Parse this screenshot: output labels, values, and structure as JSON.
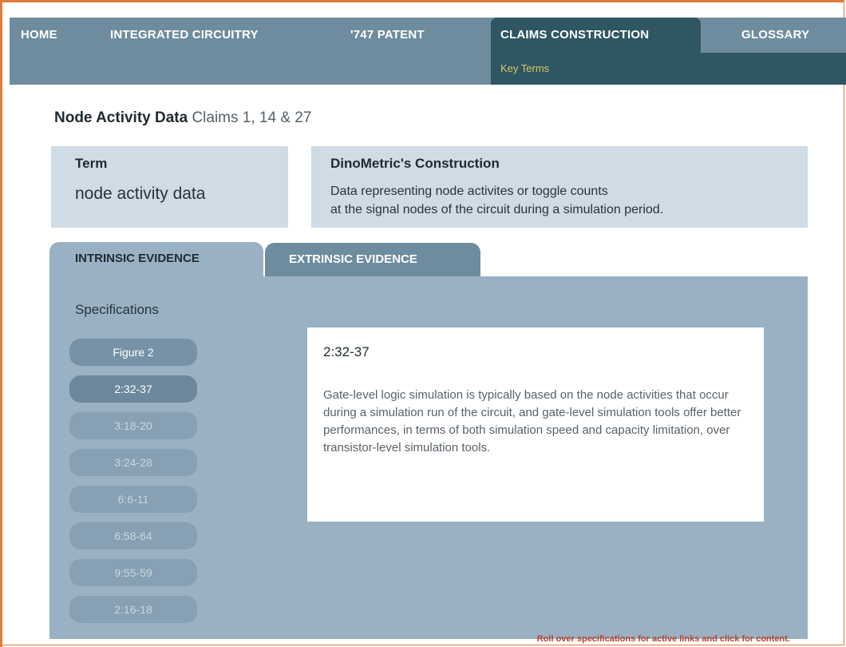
{
  "nav": {
    "home": "HOME",
    "integrated_circuitry": "INTEGRATED CIRCUITRY",
    "patent": "'747 PATENT",
    "claims_construction": "CLAIMS CONSTRUCTION",
    "glossary": "GLOSSARY",
    "subnav_key_terms": "Key Terms"
  },
  "page": {
    "title": "Node Activity Data",
    "claims": "Claims 1, 14 & 27"
  },
  "term": {
    "heading": "Term",
    "value": "node activity data"
  },
  "construction": {
    "heading": "DinoMetric's Construction",
    "line1": "Data representing node activites or toggle counts",
    "line2": "at the signal nodes of the circuit during a simulation period."
  },
  "tabs": {
    "intrinsic": "INTRINSIC EVIDENCE",
    "extrinsic": "EXTRINSIC EVIDENCE"
  },
  "specifications": {
    "heading": "Specifications",
    "items": [
      "Figure 2",
      "2:32-37",
      "3:18-20",
      "3:24-28",
      "6:6-11",
      "6:58-64",
      "9:55-59",
      "2:16-18"
    ]
  },
  "content": {
    "title": "2:32-37",
    "body": "Gate-level logic simulation is typically based on the node activities that occur during a simulation run of the circuit, and gate-level simulation tools offer better performances, in terms of both simulation speed and capacity limitation, over transistor-level simulation tools."
  },
  "hint": "Roll over specifications for active links and click for content.",
  "colors": {
    "nav_bg": "#6f8c9f",
    "nav_active": "#2e5663",
    "subnav_text": "#d8c866",
    "panel_bg": "#99b1c3",
    "box_bg": "#cfdbe5",
    "hint_text": "#b2452e",
    "frame": "#e07a3a"
  }
}
